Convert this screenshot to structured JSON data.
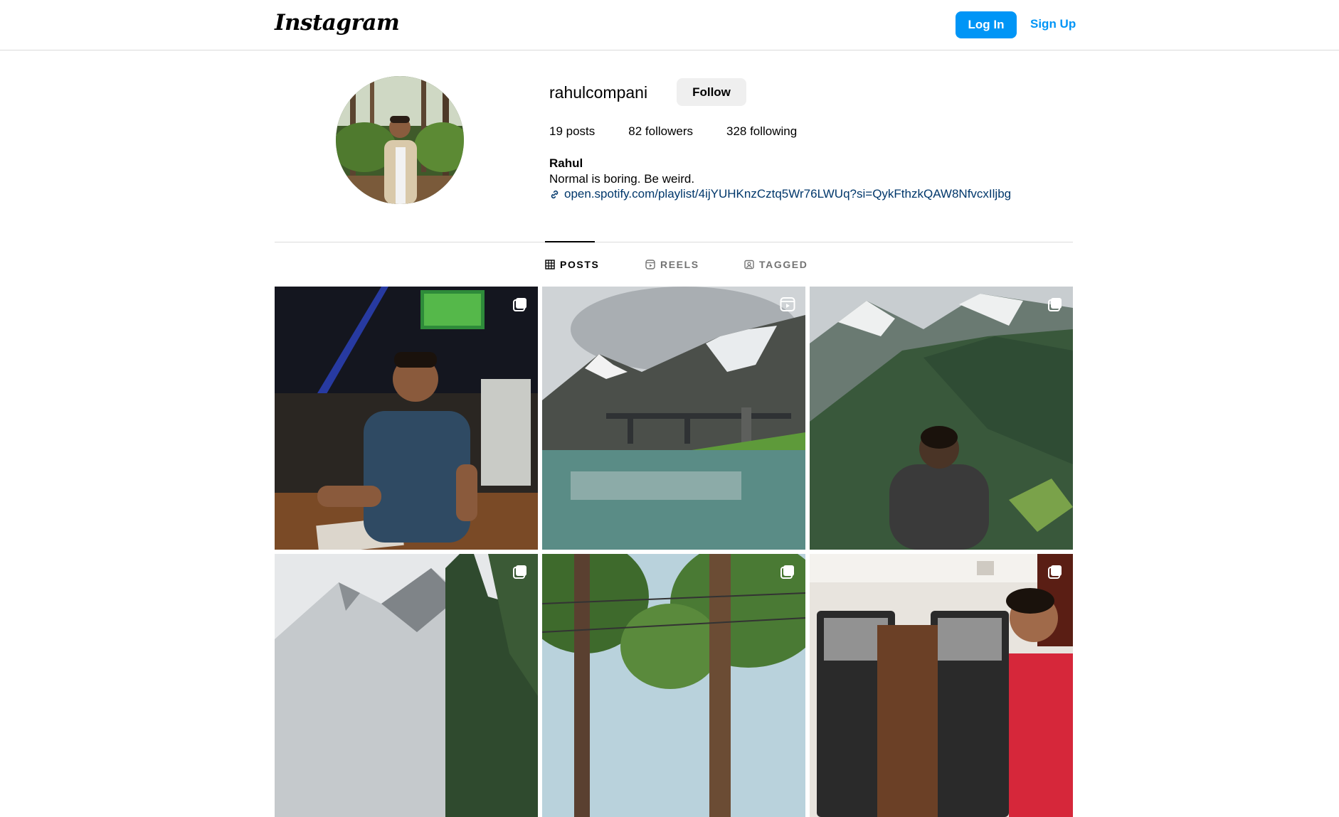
{
  "header": {
    "logo": "Instagram",
    "login_label": "Log In",
    "signup_label": "Sign Up"
  },
  "profile": {
    "username": "rahulcompani",
    "follow_label": "Follow",
    "stats": {
      "posts": "19 posts",
      "followers": "82 followers",
      "following": "328 following"
    },
    "full_name": "Rahul",
    "bio": "Normal is boring. Be weird.",
    "link": "open.spotify.com/playlist/4ijYUHKnzCztq5Wr76LWUq?si=QykFthzkQAW8NfvcxIljbg"
  },
  "tabs": [
    {
      "label": "POSTS",
      "icon": "grid-icon",
      "active": true
    },
    {
      "label": "REELS",
      "icon": "reels-icon",
      "active": false
    },
    {
      "label": "TAGGED",
      "icon": "tagged-icon",
      "active": false
    }
  ],
  "posts": [
    {
      "badge": "carousel-icon"
    },
    {
      "badge": "reel-icon"
    },
    {
      "badge": "carousel-icon"
    },
    {
      "badge": "carousel-icon"
    },
    {
      "badge": "carousel-icon"
    },
    {
      "badge": "carousel-icon"
    }
  ],
  "colors": {
    "accent": "#0095f6",
    "link": "#00376b",
    "border": "#dbdbdb"
  }
}
